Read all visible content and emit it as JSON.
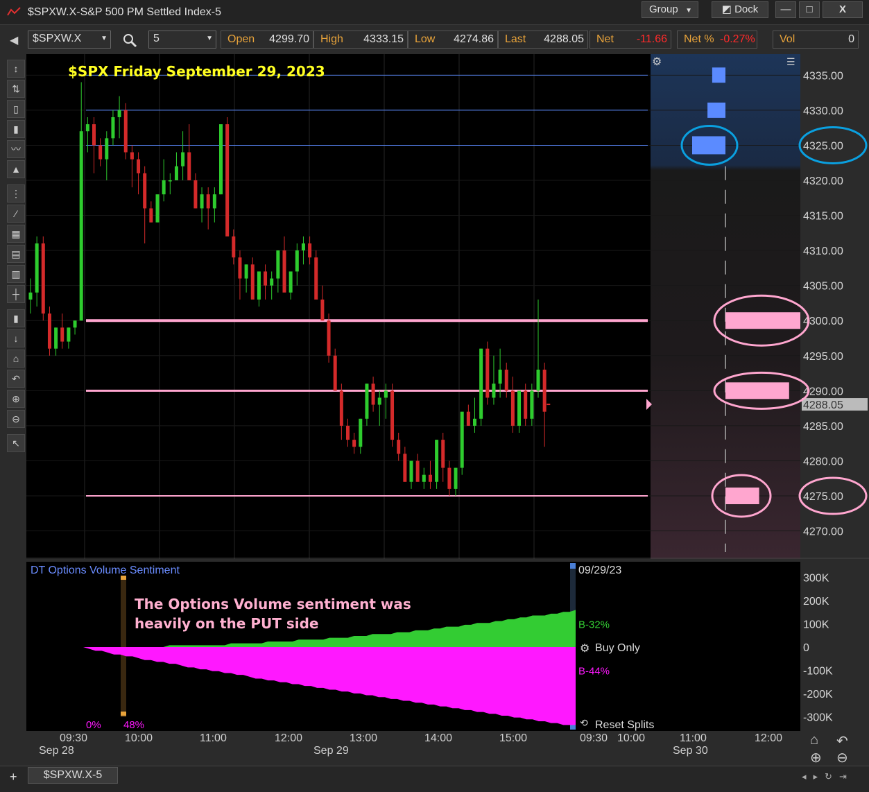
{
  "window": {
    "title": "$SPXW.X-S&P 500 PM Settled Index-5",
    "group_label": "Group",
    "dock_label": "Dock",
    "minimize": "—",
    "maximize": "□",
    "close": "X"
  },
  "toolbar": {
    "symbol": "$SPXW.X",
    "interval": "5",
    "quotes": [
      {
        "label": "Open",
        "value": "4299.70"
      },
      {
        "label": "High",
        "value": "4333.15"
      },
      {
        "label": "Low",
        "value": "4274.86"
      },
      {
        "label": "Last",
        "value": "4288.05"
      },
      {
        "label": "Net",
        "value": "-11.66"
      },
      {
        "label": "Net %",
        "value": "-0.27%"
      },
      {
        "label": "Vol",
        "value": "0"
      }
    ]
  },
  "chart": {
    "annotation_title": "$SPX Friday September 29, 2023",
    "price_ticks": [
      "4335.00",
      "4330.00",
      "4325.00",
      "4320.00",
      "4315.00",
      "4310.00",
      "4305.00",
      "4300.00",
      "4295.00",
      "4290.00",
      "4285.00",
      "4280.00",
      "4275.00",
      "4270.00"
    ],
    "last_price_label": "4288.05",
    "colors": {
      "up": "#2ecc2e",
      "down": "#d42a2a",
      "pink": "#ffa6cf",
      "blue": "#5b8bff",
      "magenta": "#ff18ff",
      "green_area": "#33cc33"
    }
  },
  "indicator": {
    "name": "DT Options Volume Sentiment",
    "date_label": "09/29/23",
    "annotation": [
      "The Options Volume sentiment was",
      "heavily on the PUT side"
    ],
    "y_ticks": [
      "300K",
      "200K",
      "100K",
      "0",
      "-100K",
      "-200K",
      "-300K"
    ],
    "buy_label": "B-32%",
    "sell_label": "B-44%",
    "buy_only": "Buy Only",
    "reset_splits": "Reset Splits",
    "pct_left": "0%",
    "pct_right": "48%"
  },
  "xaxis": {
    "times": [
      "09:30",
      "10:00",
      "11:00",
      "12:00",
      "13:00",
      "14:00",
      "15:00",
      "09:30",
      "10:00",
      "11:00",
      "12:00"
    ],
    "dates": [
      "Sep 28",
      "Sep 29",
      "Sep 30"
    ]
  },
  "bottom": {
    "tab_label": "$SPXW.X-5",
    "add": "+"
  },
  "chart_data": {
    "type": "candlestick",
    "title": "$SPX Friday September 29, 2023",
    "ylim": [
      4266,
      4338
    ],
    "ohlc": [
      [
        4303,
        4306,
        4301,
        4304
      ],
      [
        4304,
        4312,
        4302,
        4311
      ],
      [
        4311,
        4312,
        4300,
        4301
      ],
      [
        4301,
        4302,
        4295,
        4296
      ],
      [
        4296,
        4299,
        4295,
        4299
      ],
      [
        4299,
        4301,
        4296,
        4297
      ],
      [
        4297,
        4299,
        4296,
        4299
      ],
      [
        4299,
        4300,
        4298,
        4300
      ],
      [
        4300,
        4334,
        4300,
        4327
      ],
      [
        4327,
        4329,
        4324,
        4328
      ],
      [
        4328,
        4329,
        4321,
        4325
      ],
      [
        4325,
        4326,
        4322,
        4323
      ],
      [
        4323,
        4327,
        4320,
        4326
      ],
      [
        4326,
        4330,
        4325,
        4329
      ],
      [
        4329,
        4332,
        4326,
        4330
      ],
      [
        4330,
        4331,
        4323,
        4324
      ],
      [
        4324,
        4325,
        4319,
        4323
      ],
      [
        4323,
        4324,
        4318,
        4321
      ],
      [
        4321,
        4322,
        4311,
        4316
      ],
      [
        4316,
        4317,
        4314,
        4314
      ],
      [
        4314,
        4317,
        4314,
        4318
      ],
      [
        4318,
        4323,
        4317,
        4320
      ],
      [
        4320,
        4321,
        4318,
        4320
      ],
      [
        4320,
        4324,
        4320,
        4322
      ],
      [
        4322,
        4327,
        4320,
        4324
      ],
      [
        4324,
        4328,
        4320,
        4320
      ],
      [
        4320,
        4321,
        4316,
        4316
      ],
      [
        4316,
        4319,
        4314,
        4318
      ],
      [
        4318,
        4319,
        4313,
        4316
      ],
      [
        4316,
        4319,
        4314,
        4318
      ],
      [
        4318,
        4322,
        4318,
        4328
      ],
      [
        4328,
        4329,
        4320,
        4312
      ],
      [
        4312,
        4313,
        4308,
        4309
      ],
      [
        4309,
        4310,
        4303,
        4306
      ],
      [
        4306,
        4308,
        4304,
        4308
      ],
      [
        4308,
        4309,
        4304,
        4303
      ],
      [
        4303,
        4307,
        4302,
        4307
      ],
      [
        4307,
        4308,
        4303,
        4305
      ],
      [
        4305,
        4307,
        4303,
        4306
      ],
      [
        4306,
        4310,
        4304,
        4310
      ],
      [
        4310,
        4312,
        4306,
        4304
      ],
      [
        4304,
        4306,
        4303,
        4307
      ],
      [
        4307,
        4311,
        4305,
        4310
      ],
      [
        4310,
        4312,
        4308,
        4311
      ],
      [
        4311,
        4312,
        4308,
        4309
      ],
      [
        4309,
        4310,
        4305,
        4303
      ],
      [
        4303,
        4305,
        4300,
        4300
      ],
      [
        4300,
        4301,
        4294,
        4295
      ],
      [
        4295,
        4296,
        4290,
        4290
      ],
      [
        4290,
        4291,
        4283,
        4285
      ],
      [
        4285,
        4286,
        4282,
        4283
      ],
      [
        4283,
        4284,
        4281,
        4282
      ],
      [
        4282,
        4286,
        4281,
        4286
      ],
      [
        4286,
        4291,
        4285,
        4291
      ],
      [
        4291,
        4292,
        4287,
        4288
      ],
      [
        4288,
        4290,
        4285,
        4289
      ],
      [
        4289,
        4291,
        4286,
        4290
      ],
      [
        4290,
        4291,
        4282,
        4283
      ],
      [
        4283,
        4284,
        4280,
        4281
      ],
      [
        4281,
        4282,
        4277,
        4277
      ],
      [
        4277,
        4280,
        4276,
        4280
      ],
      [
        4280,
        4281,
        4277,
        4277
      ],
      [
        4277,
        4279,
        4276,
        4278
      ],
      [
        4278,
        4280,
        4276,
        4277
      ],
      [
        4277,
        4283,
        4276,
        4283
      ],
      [
        4283,
        4284,
        4277,
        4279
      ],
      [
        4279,
        4280,
        4275,
        4276
      ],
      [
        4276,
        4279,
        4275,
        4279
      ],
      [
        4279,
        4287,
        4278,
        4287
      ],
      [
        4287,
        4288,
        4285,
        4285
      ],
      [
        4285,
        4289,
        4284,
        4286
      ],
      [
        4286,
        4296,
        4285,
        4296
      ],
      [
        4296,
        4297,
        4288,
        4289
      ],
      [
        4289,
        4295,
        4288,
        4291
      ],
      [
        4291,
        4296,
        4289,
        4293
      ],
      [
        4293,
        4294,
        4289,
        4290
      ],
      [
        4290,
        4292,
        4284,
        4285
      ],
      [
        4285,
        4290,
        4284,
        4290
      ],
      [
        4290,
        4291,
        4285,
        4286
      ],
      [
        4286,
        4291,
        4285,
        4290
      ],
      [
        4290,
        4303,
        4289,
        4293
      ],
      [
        4293,
        4294,
        4282,
        4287
      ]
    ],
    "pink_lines": [
      4300,
      4290,
      4275
    ],
    "blue_lines": [
      4335,
      4330,
      4325
    ],
    "blue_bars": [
      {
        "price": 4335,
        "size": 0.15
      },
      {
        "price": 4330,
        "size": 0.35
      },
      {
        "price": 4325,
        "size": 1.0
      }
    ],
    "pink_bars": [
      {
        "price": 4300,
        "size": 1.0
      },
      {
        "price": 4290,
        "size": 0.85
      },
      {
        "price": 4275,
        "size": 0.45
      }
    ],
    "sentiment": {
      "ylim": [
        -350,
        350
      ],
      "buy_end": 160,
      "sell_end": -340
    }
  }
}
